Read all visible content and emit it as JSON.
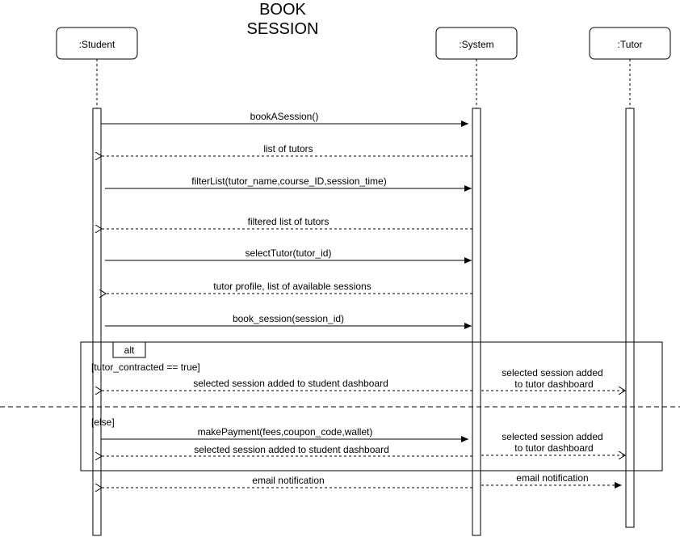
{
  "title": {
    "line1": "BOOK",
    "line2": "SESSION"
  },
  "participants": [
    ":Student",
    ":System",
    ":Tutor"
  ],
  "messages": {
    "m1": "bookASession()",
    "m2": "list of tutors",
    "m3": "filterList(tutor_name,course_ID,session_time)",
    "m4": "filtered list of tutors",
    "m5": "selectTutor(tutor_id)",
    "m6": "tutor profile, list of available sessions",
    "m7": "book_session(session_id)",
    "m8": "selected session added to student dashboard",
    "m9a": "selected session added",
    "m9b": "to tutor dashboard",
    "m10": "makePayment(fees,coupon_code,wallet)",
    "m11": "selected session added to student dashboard",
    "m12a": "selected session added",
    "m12b": "to tutor dashboard",
    "m13": "email notification",
    "m14": "email notification"
  },
  "fragment": {
    "operator": "alt",
    "guard1": "[tutor_contracted == true]",
    "guard2": "[else]"
  }
}
